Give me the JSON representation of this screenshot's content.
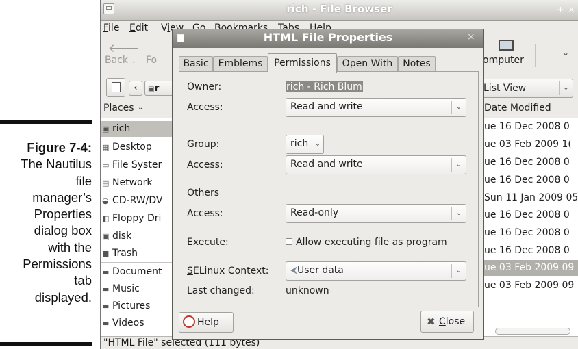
{
  "caption": {
    "figure": "Figure 7-4:",
    "text_lines": [
      "The Nautilus",
      "file",
      "manager’s",
      "Properties",
      "dialog box",
      "with the",
      "Permissions",
      "tab",
      "displayed."
    ]
  },
  "window": {
    "title": "rich - File Browser",
    "minimize": "–",
    "maximize": "+",
    "close": "×"
  },
  "menu": {
    "file_u": "F",
    "file_rest": "ile",
    "edit_u": "E",
    "edit_rest": "dit",
    "view_a": "V",
    "view_u": "i",
    "view_rest": "ew",
    "go": "Go",
    "bookmarks": "Bookmarks",
    "tabs": "Tabs",
    "help": "Help"
  },
  "toolbar": {
    "back": "Back",
    "forward": "Fo",
    "computer": "omputer",
    "back_icon": "arrow-left-icon",
    "computer_icon": "monitor-icon"
  },
  "location": {
    "path_crumb": "r",
    "view_mode": "List View"
  },
  "sidebar": {
    "header": "Places",
    "items": [
      {
        "label": "rich",
        "icon": "home-icon"
      },
      {
        "label": "Desktop",
        "icon": "desktop-icon"
      },
      {
        "label": "File Syster",
        "icon": "drive-icon"
      },
      {
        "label": "Network",
        "icon": "network-icon"
      },
      {
        "label": "CD-RW/DV",
        "icon": "disc-icon"
      },
      {
        "label": "Floppy Dri",
        "icon": "floppy-icon"
      },
      {
        "label": "disk",
        "icon": "disk-icon"
      },
      {
        "label": "Trash",
        "icon": "trash-icon"
      },
      {
        "label": "Document",
        "icon": "folder-icon"
      },
      {
        "label": "Music",
        "icon": "folder-icon"
      },
      {
        "label": "Pictures",
        "icon": "folder-icon"
      },
      {
        "label": "Videos",
        "icon": "folder-icon"
      }
    ]
  },
  "filelist": {
    "column": "Date Modified",
    "dates": [
      "ue 16 Dec 2008 0",
      "ue 03 Feb 2009 1(",
      "ue 16 Dec 2008 0",
      "ue 16 Dec 2008 0",
      "Sun 11 Jan 2009 05",
      "ue 16 Dec 2008 0",
      "ue 16 Dec 2008 0",
      "ue 16 Dec 2008 0",
      "ue 03 Feb 2009 09",
      "ue 03 Feb 2009 09"
    ]
  },
  "status": "\"HTML File\" selected (111 bytes)",
  "dialog": {
    "title": "HTML File Properties",
    "close": "×",
    "tabs": [
      "Basic",
      "Emblems",
      "Permissions",
      "Open With",
      "Notes"
    ],
    "owner_label": "Owner:",
    "owner_value": "rich - Rich Blum",
    "access_label": "Access:",
    "owner_access": "Read and write",
    "group_label_u": "G",
    "group_label_rest": "roup:",
    "group_value": "rich",
    "group_access": "Read and write",
    "others_label": "Others",
    "others_access": "Read-only",
    "execute_label": "Execute:",
    "execute_text_a": "Allow ",
    "execute_text_u": "e",
    "execute_text_b": "xecuting file as program",
    "selinux_label_u": "S",
    "selinux_label_rest": "ELinux Context:",
    "selinux_value": "User data",
    "changed_label": "Last changed:",
    "changed_value": "unknown",
    "help_u": "H",
    "help_rest": "elp",
    "close_u": "C",
    "close_rest": "lose"
  }
}
